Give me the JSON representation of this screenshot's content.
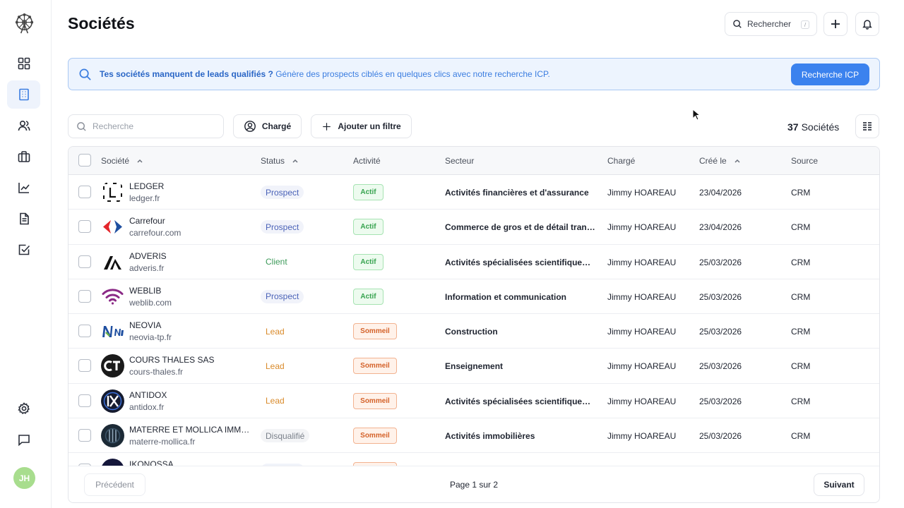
{
  "page": {
    "title": "Sociétés"
  },
  "user": {
    "initials": "JH"
  },
  "header": {
    "search_label": "Rechercher",
    "search_shortcut": "/"
  },
  "banner": {
    "bold_text": "Tes sociétés manquent de leads qualifiés ?",
    "text": " Génère des prospects ciblés en quelques clics avec notre recherche ICP.",
    "button": "Recherche ICP"
  },
  "toolbar": {
    "search_placeholder": "Recherche",
    "owner_filter": "Chargé",
    "add_filter": "Ajouter un filtre",
    "count": "37",
    "count_label": "Sociétés"
  },
  "table": {
    "columns": {
      "company": "Société",
      "status": "Status",
      "activity": "Activité",
      "sector": "Secteur",
      "owner": "Chargé",
      "created": "Créé le",
      "source": "Source"
    },
    "rows": [
      {
        "name": "LEDGER",
        "domain": "ledger.fr",
        "status": "Prospect",
        "activity": "Actif",
        "sector": "Activités financières et d'assurance",
        "owner": "Jimmy HOAREAU",
        "created": "23/04/2026",
        "source": "CRM"
      },
      {
        "name": "Carrefour",
        "domain": "carrefour.com",
        "status": "Prospect",
        "activity": "Actif",
        "sector": "Commerce de gros et de détail tran…",
        "owner": "Jimmy HOAREAU",
        "created": "23/04/2026",
        "source": "CRM"
      },
      {
        "name": "ADVERIS",
        "domain": "adveris.fr",
        "status": "Client",
        "activity": "Actif",
        "sector": "Activités spécialisées scientifique…",
        "owner": "Jimmy HOAREAU",
        "created": "25/03/2026",
        "source": "CRM"
      },
      {
        "name": "WEBLIB",
        "domain": "weblib.com",
        "status": "Prospect",
        "activity": "Actif",
        "sector": "Information et communication",
        "owner": "Jimmy HOAREAU",
        "created": "25/03/2026",
        "source": "CRM"
      },
      {
        "name": "NEOVIA",
        "domain": "neovia-tp.fr",
        "status": "Lead",
        "activity": "Sommeil",
        "sector": "Construction",
        "owner": "Jimmy HOAREAU",
        "created": "25/03/2026",
        "source": "CRM"
      },
      {
        "name": "COURS THALES SAS",
        "domain": "cours-thales.fr",
        "status": "Lead",
        "activity": "Sommeil",
        "sector": "Enseignement",
        "owner": "Jimmy HOAREAU",
        "created": "25/03/2026",
        "source": "CRM"
      },
      {
        "name": "ANTIDOX",
        "domain": "antidox.fr",
        "status": "Lead",
        "activity": "Sommeil",
        "sector": "Activités spécialisées scientifique…",
        "owner": "Jimmy HOAREAU",
        "created": "25/03/2026",
        "source": "CRM"
      },
      {
        "name": "MATERRE ET MOLLICA IMM…",
        "domain": "materre-mollica.fr",
        "status": "Disqualifié",
        "activity": "Sommeil",
        "sector": "Activités immobilières",
        "owner": "Jimmy HOAREAU",
        "created": "25/03/2026",
        "source": "CRM"
      },
      {
        "name": "IKONOSSA",
        "domain": "",
        "status": "",
        "activity": "",
        "sector": "",
        "owner": "",
        "created": "",
        "source": ""
      }
    ]
  },
  "pagination": {
    "previous": "Précédent",
    "info": "Page 1 sur 2",
    "next": "Suivant"
  }
}
